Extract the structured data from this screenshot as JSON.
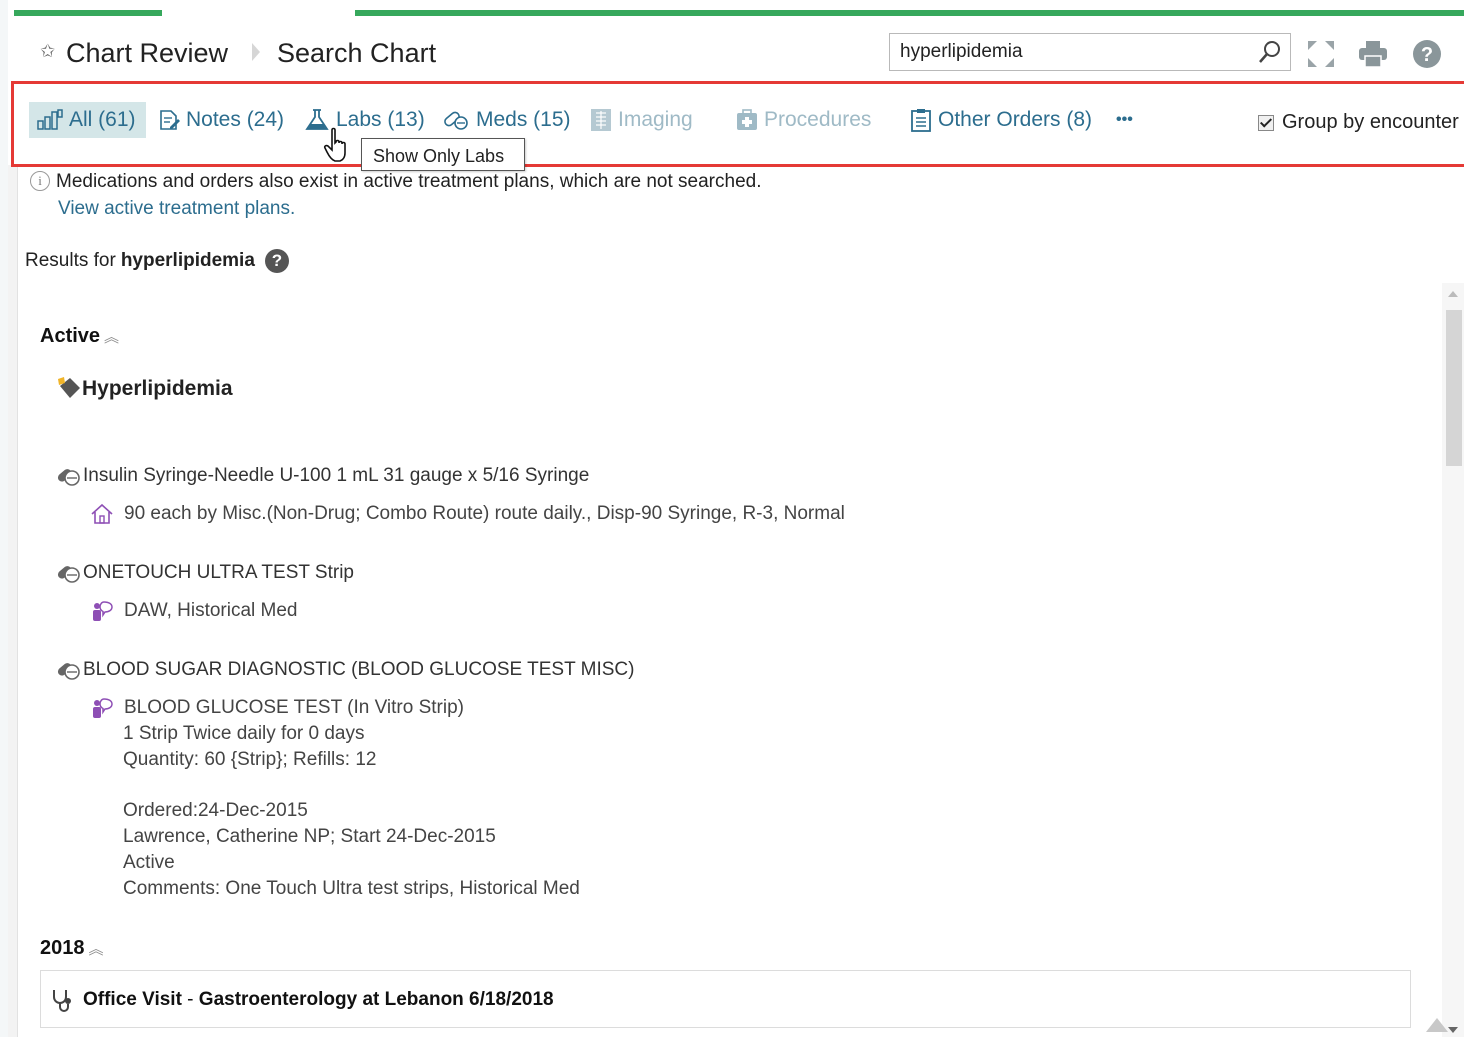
{
  "header": {
    "breadcrumb_parent": "Chart Review",
    "breadcrumb_current": "Search Chart",
    "search_value": "hyperlipidemia",
    "icons": [
      "pin-icon",
      "search-icon",
      "expand-icon",
      "print-icon",
      "help-icon"
    ]
  },
  "toolbar": {
    "all_label": "All (61)",
    "notes_label": "Notes (24)",
    "labs_label": "Labs (13)",
    "meds_label": "Meds (15)",
    "imaging_label": "Imaging",
    "procedures_label": "Procedures",
    "other_orders_label": "Other Orders (8)",
    "more_label": "•••",
    "group_by_label": "Group by encounter",
    "group_by_checked": true,
    "tooltip": "Show Only Labs"
  },
  "info": {
    "message": "Medications and orders also exist in active treatment plans, which are not searched.",
    "link": "View active treatment plans."
  },
  "results": {
    "prefix": "Results for",
    "term": "hyperlipidemia"
  },
  "active_section": {
    "heading": "Active",
    "chevron": "≈",
    "problem": "Hyperlipidemia",
    "meds": [
      {
        "name": "Insulin Syringe-Needle U-100 1 mL 31 gauge x 5/16 Syringe",
        "sub": "90 each by Misc.(Non-Drug; Combo Route) route daily., Disp-90 Syringe, R-3, Normal"
      },
      {
        "name": "ONETOUCH ULTRA TEST Strip",
        "sub": "DAW, Historical Med"
      },
      {
        "name": "BLOOD SUGAR DIAGNOSTIC (BLOOD GLUCOSE TEST MISC)",
        "sub": "BLOOD GLUCOSE TEST (In Vitro Strip)",
        "details": [
          "1 Strip Twice daily for 0 days",
          "Quantity: 60 {Strip};  Refills: 12",
          "Ordered:24-Dec-2015",
          "Lawrence, Catherine NP;  Start 24-Dec-2015",
          "Active",
          "Comments: One Touch Ultra test strips, Historical Med"
        ]
      }
    ]
  },
  "year_section": {
    "heading": "2018",
    "visit_type": "Office Visit",
    "visit_separator": " - ",
    "visit_detail": "Gastroenterology at Lebanon 6/18/2018"
  },
  "colors": {
    "accent_green": "#36a85c",
    "link_blue": "#2c6d8e",
    "highlight_red": "#e53935",
    "active_tab_bg": "#d4e6e8",
    "med_purple": "#8e4fb5"
  }
}
